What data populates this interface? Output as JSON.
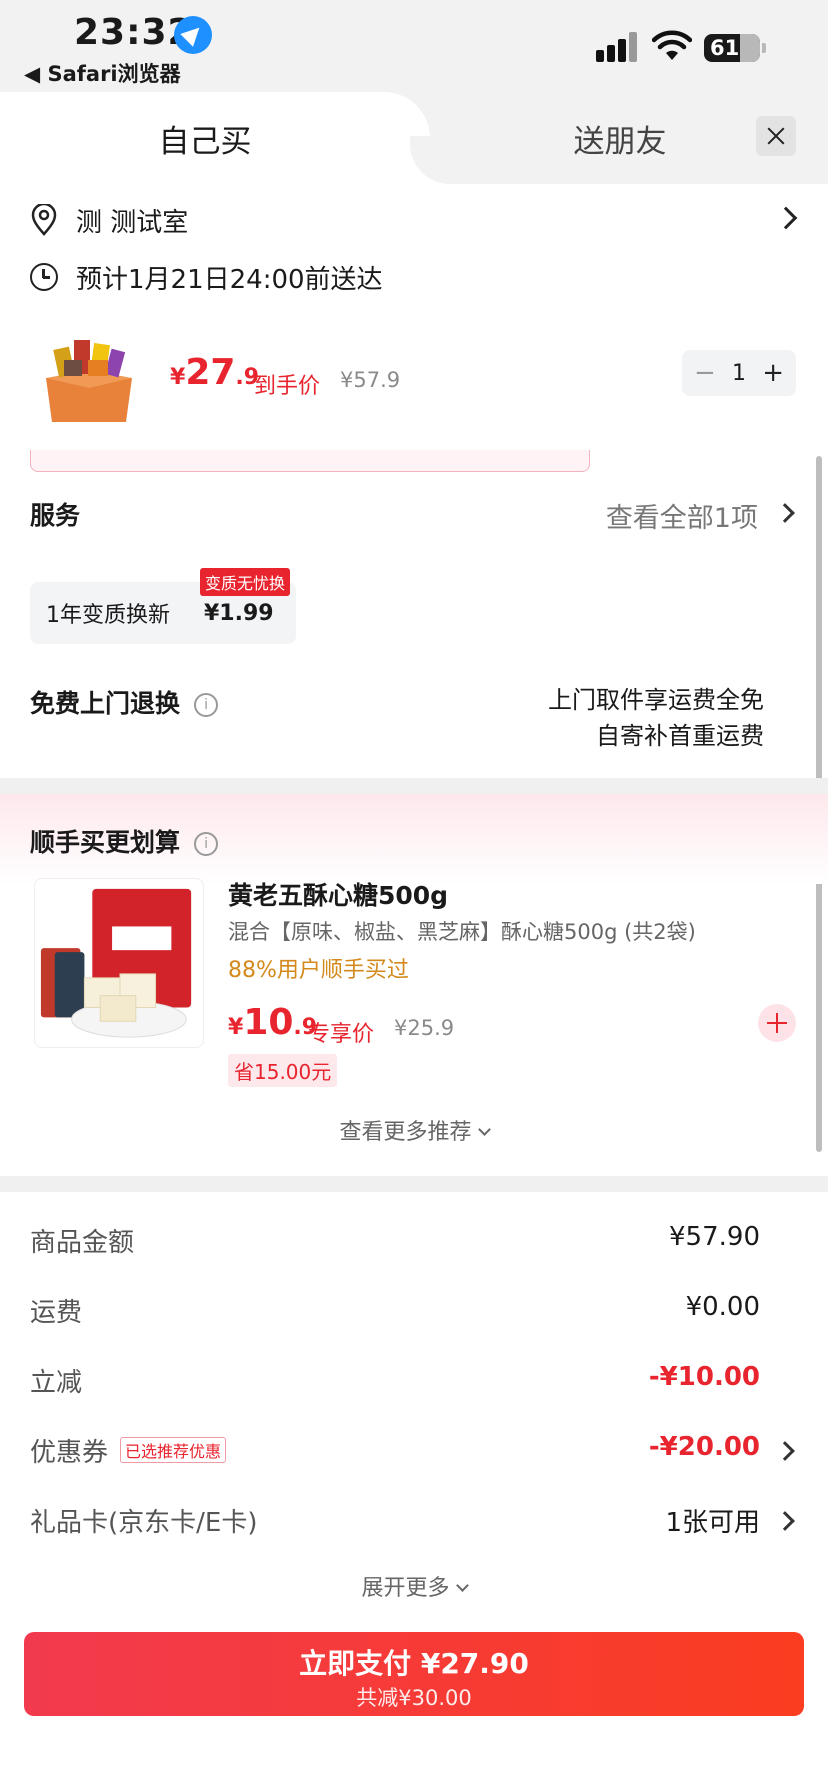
{
  "status_bar": {
    "time": "23:32",
    "back_app": "◀ Safari浏览器",
    "battery": "61"
  },
  "tabs": {
    "self_buy": "自己买",
    "gift_friend": "送朋友"
  },
  "address": {
    "text": "测  测试室"
  },
  "delivery": {
    "eta": "预计1月21日24:00前送达"
  },
  "product": {
    "price_currency": "¥",
    "price_int": "27",
    "price_dec": ".9",
    "price_tag": "到手价",
    "original_price": "¥57.9",
    "quantity": "1",
    "minus": "−",
    "plus": "+"
  },
  "services": {
    "title": "服务",
    "view_all": "查看全部1项",
    "card_label": "1年变质换新",
    "card_price": "¥1.99",
    "card_badge": "变质无忧换",
    "return_title": "免费上门退换",
    "return_line1": "上门取件享运费全免",
    "return_line2": "自寄补首重运费",
    "info_symbol": "i"
  },
  "recommend": {
    "title": "顺手买更划算",
    "name": "黄老五酥心糖500g",
    "desc": "混合【原味、椒盐、黑芝麻】酥心糖500g (共2袋)",
    "bought": "88%用户顺手买过",
    "price_currency": "¥",
    "price_int": "10",
    "price_dec": ".9",
    "price_tag": "专享价",
    "original_price": "¥25.9",
    "save": "省15.00元",
    "see_more": "查看更多推荐"
  },
  "summary": {
    "goods_label": "商品金额",
    "goods_value": "¥57.90",
    "shipping_label": "运费",
    "shipping_value": "¥0.00",
    "discount_label": "立减",
    "discount_value": "-¥10.00",
    "coupon_label": "优惠券",
    "coupon_badge": "已选推荐优惠",
    "coupon_value": "-¥20.00",
    "giftcard_label": "礼品卡(京东卡/E卡)",
    "giftcard_value": "1张可用",
    "expand_more": "展开更多"
  },
  "pay": {
    "main": "立即支付 ¥27.90",
    "sub": "共减¥30.00"
  },
  "colors": {
    "accent_red": "#e8242e",
    "bought_orange": "#d4891c"
  }
}
